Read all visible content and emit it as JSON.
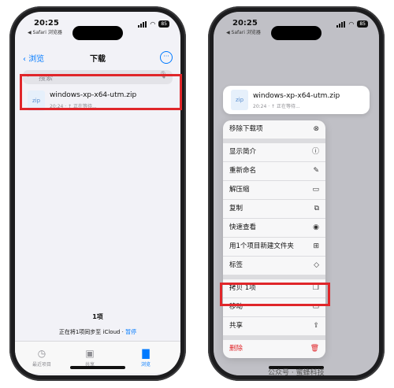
{
  "status": {
    "time": "20:25",
    "back_app": "◀ Safari 浏览器",
    "battery": "85"
  },
  "nav": {
    "back_label": "浏览",
    "title": "下载",
    "more": "···"
  },
  "search": {
    "placeholder": "搜索",
    "icon": "magnifier-icon",
    "mic": "mic-icon"
  },
  "file": {
    "icon_label": "zip",
    "name": "windows-xp-x64-utm.zip",
    "meta": "20:24 · ↑ 正在等待..."
  },
  "footer": {
    "count": "1项",
    "sync_text": "正在将1项同步至 iCloud · ",
    "pause": "暂停"
  },
  "tabs": [
    {
      "label": "最近项目",
      "icon": "clock-icon"
    },
    {
      "label": "共享",
      "icon": "shared-folder-icon"
    },
    {
      "label": "浏览",
      "icon": "folder-icon"
    }
  ],
  "menu": {
    "group1": [
      {
        "label": "移除下载项",
        "icon": "⊗"
      }
    ],
    "group2": [
      {
        "label": "显示简介",
        "icon": "ⓘ"
      },
      {
        "label": "重新命名",
        "icon": "✎"
      },
      {
        "label": "解压缩",
        "icon": "▭"
      },
      {
        "label": "复制",
        "icon": "⧉"
      },
      {
        "label": "快速查看",
        "icon": "◉"
      },
      {
        "label": "用1个项目新建文件夹",
        "icon": "⊞"
      },
      {
        "label": "标签",
        "icon": "◇"
      }
    ],
    "group3": [
      {
        "label": "拷贝 1项",
        "icon": "❐"
      },
      {
        "label": "移动",
        "icon": "▭"
      },
      {
        "label": "共享",
        "icon": "⇪"
      }
    ],
    "group4": [
      {
        "label": "删除",
        "icon": "🗑"
      }
    ]
  },
  "watermark": "公众号 · 蜜蜂科技",
  "colors": {
    "accent": "#007aff",
    "highlight": "#e0262a",
    "danger": "#e0262a"
  }
}
